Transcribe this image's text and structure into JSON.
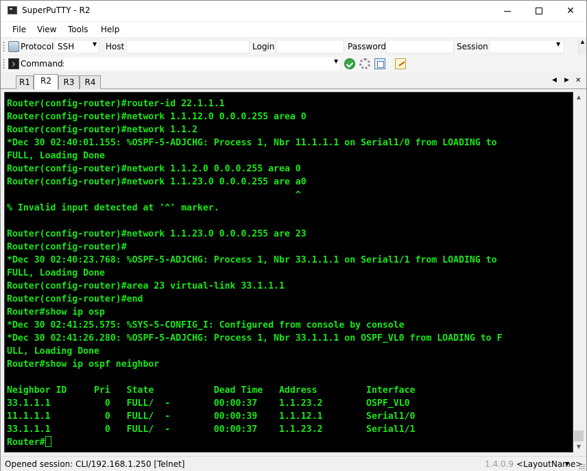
{
  "window": {
    "title": "SuperPuTTY - R2",
    "minimize_glyph": "",
    "maximize_glyph": "",
    "close_glyph": "✕"
  },
  "menu": {
    "file": "File",
    "view": "View",
    "tools": "Tools",
    "help": "Help"
  },
  "toolbar1": {
    "protocol_label": "Protocol",
    "protocol_value": "SSH",
    "host_label": "Host",
    "host_value": "",
    "login_label": "Login",
    "login_value": "",
    "password_label": "Password",
    "password_value": "",
    "session_label": "Session",
    "session_value": "",
    "dropdown_arrow": "▼"
  },
  "toolbar2": {
    "commands_label": "Commands",
    "commands_value": "",
    "dropdown_arrow": "▼",
    "icons": [
      "run-icon",
      "settings-icon",
      "paste-icon",
      "notepad-icon"
    ]
  },
  "tabs": [
    {
      "label": "R1",
      "active": false
    },
    {
      "label": "R2",
      "active": true
    },
    {
      "label": "R3",
      "active": false
    },
    {
      "label": "R4",
      "active": false
    }
  ],
  "tab_nav": {
    "left": "◀",
    "right": "▶",
    "close": "✕"
  },
  "terminal": {
    "text_color": "#18e818",
    "background": "#000000",
    "lines": [
      "Router(config-router)#router-id 22.1.1.1",
      "Router(config-router)#network 1.1.12.0 0.0.0.255 area 0",
      "Router(config-router)#network 1.1.2",
      "*Dec 30 02:40:01.155: %OSPF-5-ADJCHG: Process 1, Nbr 11.1.1.1 on Serial1/0 from LOADING to",
      "FULL, Loading Done",
      "Router(config-router)#network 1.1.2.0 0.0.0.255 area 0",
      "Router(config-router)#network 1.1.23.0 0.0.0.255 are a0",
      "                                                     ^",
      "% Invalid input detected at '^' marker.",
      "",
      "Router(config-router)#network 1.1.23.0 0.0.0.255 are 23",
      "Router(config-router)#",
      "*Dec 30 02:40:23.768: %OSPF-5-ADJCHG: Process 1, Nbr 33.1.1.1 on Serial1/1 from LOADING to",
      "FULL, Loading Done",
      "Router(config-router)#area 23 virtual-link 33.1.1.1",
      "Router(config-router)#end",
      "Router#show ip osp",
      "*Dec 30 02:41:25.575: %SYS-5-CONFIG_I: Configured from console by console",
      "*Dec 30 02:41:26.280: %OSPF-5-ADJCHG: Process 1, Nbr 33.1.1.1 on OSPF_VL0 from LOADING to F",
      "ULL, Loading Done",
      "Router#show ip ospf neighbor",
      "",
      "Neighbor ID     Pri   State           Dead Time   Address         Interface",
      "33.1.1.1          0   FULL/  -        00:00:37    1.1.23.2        OSPF_VL0",
      "11.1.1.1          0   FULL/  -        00:00:39    1.1.12.1        Serial1/0",
      "33.1.1.1          0   FULL/  -        00:00:37    1.1.23.2        Serial1/1"
    ],
    "prompt": "Router#"
  },
  "scrollbar": {
    "up": "▲",
    "down": "▼"
  },
  "statusbar": {
    "session_text": "Opened session: CLI/192.168.1.250 [Telnet]",
    "version": "1.4.0.9",
    "layout": "<LayoutName>",
    "layout_arrow": "▼"
  }
}
